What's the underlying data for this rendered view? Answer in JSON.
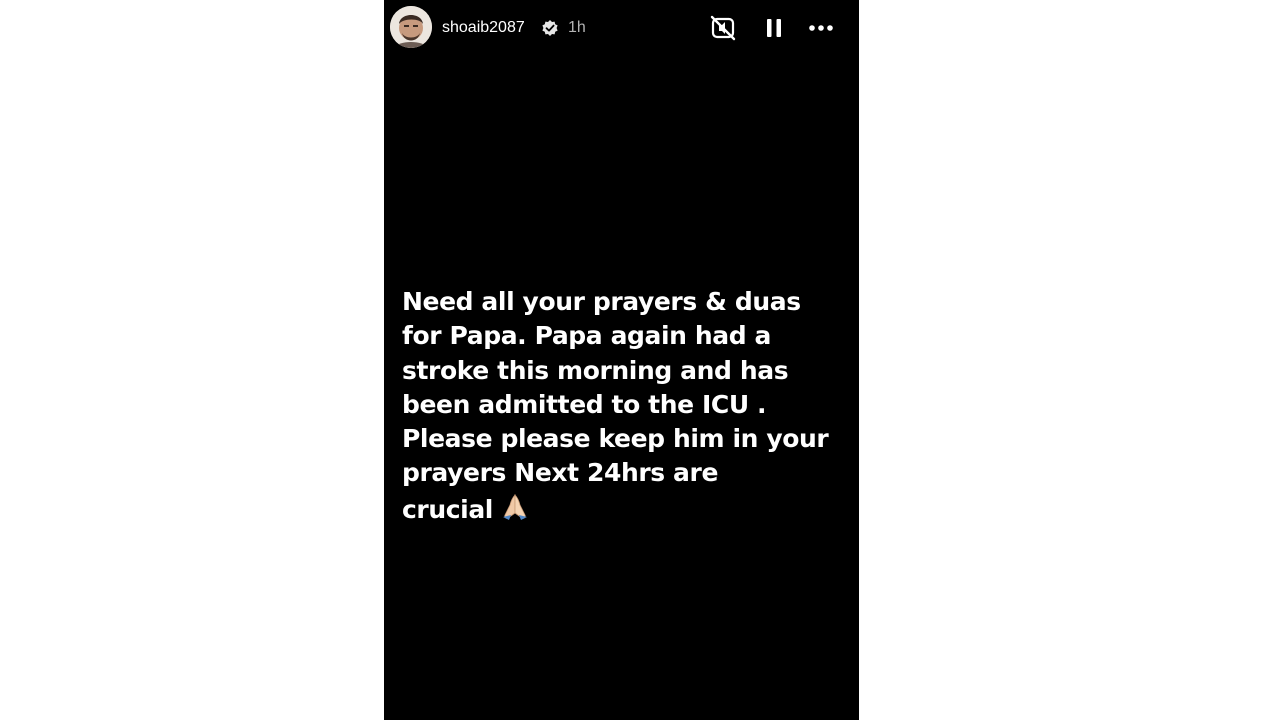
{
  "story": {
    "header": {
      "username": "shoaib2087",
      "verified": true,
      "timestamp": "1h",
      "icons": {
        "avatar": "profile-photo",
        "verified": "verified-badge-icon",
        "mute": "audio-muted-icon",
        "pause": "pause-icon",
        "more": "more-options-icon"
      }
    },
    "text": "Need all your prayers & duas\nfor Papa. Papa again had a\nstroke this morning and has\nbeen admitted to the ICU .\nPlease please keep him in your\nprayers Next 24hrs are\ncrucial",
    "emoji": "folded-hands-emoji",
    "colors": {
      "background": "#000000",
      "text": "#ffffff",
      "timestamp": "#b3b3b3",
      "page": "#ffffff"
    }
  }
}
